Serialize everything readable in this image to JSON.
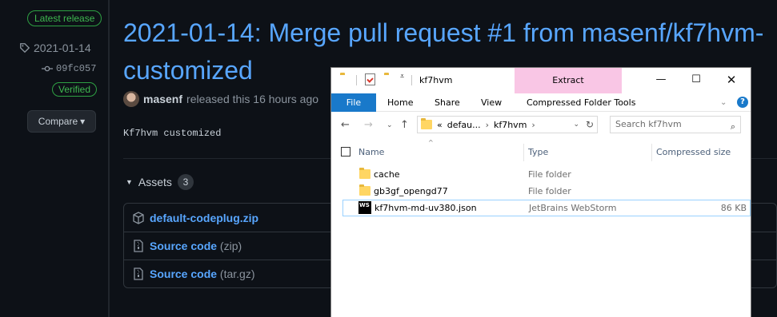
{
  "github": {
    "latest_badge": "Latest release",
    "tag": "2021-01-14",
    "commit": "09fc057",
    "verified": "Verified",
    "compare_label": "Compare",
    "title": "2021-01-14: Merge pull request #1 from masenf/kf7hvm-customized",
    "author": "masenf",
    "released_text": "released this 16 hours ago",
    "body": "Kf7hvm customized",
    "assets_label": "Assets",
    "assets_count": "3",
    "assets": [
      {
        "name": "default-codeplug.zip",
        "ext": ""
      },
      {
        "name": "Source code",
        "ext": "(zip)"
      },
      {
        "name": "Source code",
        "ext": "(tar.gz)"
      }
    ]
  },
  "explorer": {
    "window_title": "kf7hvm",
    "extract_tab": "Extract",
    "ribbon_tabs": [
      "File",
      "Home",
      "Share",
      "View",
      "Compressed Folder Tools"
    ],
    "path": [
      "defau...",
      "kf7hvm"
    ],
    "path_prefix": "«",
    "search_placeholder": "Search kf7hvm",
    "columns": {
      "name": "Name",
      "type": "Type",
      "size": "Compressed size"
    },
    "files": [
      {
        "name": "cache",
        "type": "File folder",
        "size": "",
        "icon": "folder-icon"
      },
      {
        "name": "gb3gf_opengd77",
        "type": "File folder",
        "size": "",
        "icon": "folder-icon"
      },
      {
        "name": "kf7hvm-md-uv380.json",
        "type": "JetBrains WebStorm",
        "size": "86 KB",
        "icon": "webstorm-icon"
      }
    ],
    "ws_icon_text": "WS"
  }
}
